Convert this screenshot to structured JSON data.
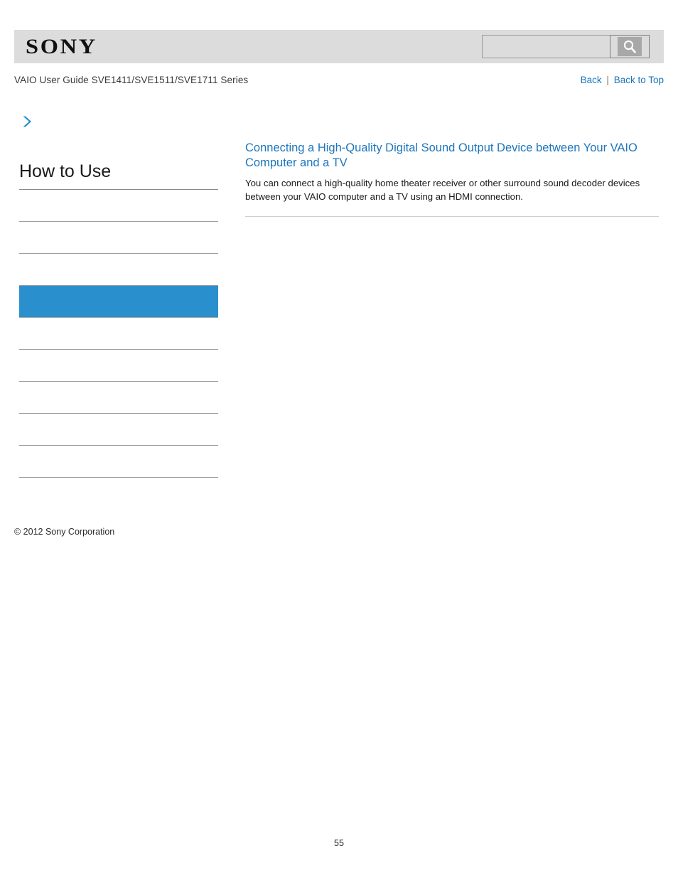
{
  "header": {
    "logo_text": "SONY",
    "logo_icon": "sony-wordmark",
    "search": {
      "value": "",
      "placeholder": "",
      "button_icon": "search-icon",
      "button_label": ""
    }
  },
  "subheader": {
    "guide_title": "VAIO User Guide SVE1411/SVE1511/SVE1711 Series",
    "nav": {
      "back_label": "Back",
      "separator": "|",
      "back_to_top_label": "Back to Top"
    }
  },
  "sidebar": {
    "breadcrumb_icon": "chevron-right-icon",
    "section_title": "How to Use",
    "items": [
      {
        "label": "",
        "selected": false
      },
      {
        "label": "",
        "selected": false
      },
      {
        "label": "",
        "selected": false
      },
      {
        "label": "",
        "selected": true
      },
      {
        "label": "",
        "selected": false
      },
      {
        "label": "",
        "selected": false
      },
      {
        "label": "",
        "selected": false
      },
      {
        "label": "",
        "selected": false
      },
      {
        "label": "",
        "selected": false
      }
    ]
  },
  "content": {
    "heading": "Connecting a High-Quality Digital Sound Output Device between Your VAIO Computer and a TV",
    "body": "You can connect a high-quality home theater receiver or other surround sound decoder devices between your VAIO computer and a TV using an HDMI connection."
  },
  "footer": {
    "copyright": "© 2012 Sony Corporation",
    "page_number": "55"
  },
  "colors": {
    "accent_blue": "#1b75bb",
    "selected_blue": "#2a8fcd",
    "header_gray": "#dcdcdc",
    "rule_gray": "#9e9e9e"
  }
}
